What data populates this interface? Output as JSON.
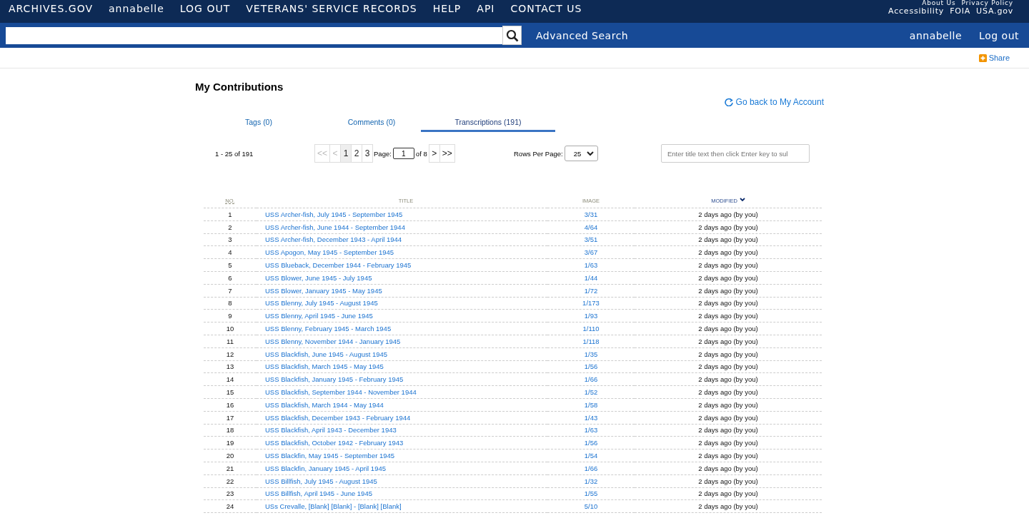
{
  "top_nav": {
    "items": [
      "ARCHIVES.GOV",
      "annabelle",
      "LOG OUT",
      "VETERANS' SERVICE RECORDS",
      "HELP",
      "API",
      "CONTACT US"
    ],
    "utility_links_top": [
      "About Us",
      "Privacy Policy"
    ],
    "utility_links": [
      "Accessibility",
      "FOIA",
      "USA.gov"
    ]
  },
  "search_bar": {
    "advanced_link": "Advanced Search",
    "user": "annabelle",
    "logout": "Log out"
  },
  "share": "Share",
  "page_title": "My Contributions",
  "back_link": "Go back to My Account",
  "tabs": [
    {
      "label": "Tags (0)",
      "selected": false
    },
    {
      "label": "Comments (0)",
      "selected": false
    },
    {
      "label": "Transcriptions (191)",
      "selected": true
    }
  ],
  "pager": {
    "range": "1 - 25 of 191",
    "buttons": [
      {
        "label": "<<",
        "disabled": true,
        "selected": false
      },
      {
        "label": "<",
        "disabled": true,
        "selected": false
      },
      {
        "label": "1",
        "disabled": false,
        "selected": true
      },
      {
        "label": "2",
        "disabled": false,
        "selected": false
      },
      {
        "label": "3",
        "disabled": false,
        "selected": false
      }
    ],
    "page_label": "Page:",
    "page_value": "1",
    "of": "of 8",
    "next_buttons": [
      ">",
      ">>"
    ],
    "rows_label": "Rows Per Page:",
    "rows_value": "25",
    "filter_placeholder": "Enter title text then click Enter key to sul"
  },
  "table": {
    "columns": [
      {
        "label": "NO.",
        "sorted": false
      },
      {
        "label": "TITLE",
        "sorted": false
      },
      {
        "label": "IMAGE",
        "sorted": false
      },
      {
        "label": "MODIFIED",
        "sorted": true
      }
    ],
    "rows": [
      [
        "1",
        "USS Archer-fish, July 1945 - September 1945",
        "3/31",
        "2 days ago (by you)"
      ],
      [
        "2",
        "USS Archer-fish, June 1944 - September 1944",
        "4/64",
        "2 days ago (by you)"
      ],
      [
        "3",
        "USS Archer-fish, December 1943 - April 1944",
        "3/51",
        "2 days ago (by you)"
      ],
      [
        "4",
        "USS Apogon, May 1945 - September 1945",
        "3/67",
        "2 days ago (by you)"
      ],
      [
        "5",
        "USS Blueback, December 1944 - February 1945",
        "1/63",
        "2 days ago (by you)"
      ],
      [
        "6",
        "USS Blower, June 1945 - July 1945",
        "1/44",
        "2 days ago (by you)"
      ],
      [
        "7",
        "USS Blower, January 1945 - May 1945",
        "1/72",
        "2 days ago (by you)"
      ],
      [
        "8",
        "USS Blenny, July 1945 - August 1945",
        "1/173",
        "2 days ago (by you)"
      ],
      [
        "9",
        "USS Blenny, April 1945 - June 1945",
        "1/93",
        "2 days ago (by you)"
      ],
      [
        "10",
        "USS Blenny, February 1945 - March 1945",
        "1/110",
        "2 days ago (by you)"
      ],
      [
        "11",
        "USS Blenny, November 1944 - January 1945",
        "1/118",
        "2 days ago (by you)"
      ],
      [
        "12",
        "USS Blackfish, June 1945 - August 1945",
        "1/35",
        "2 days ago (by you)"
      ],
      [
        "13",
        "USS Blackfish, March 1945 - May 1945",
        "1/56",
        "2 days ago (by you)"
      ],
      [
        "14",
        "USS Blackfish, January 1945 - February 1945",
        "1/66",
        "2 days ago (by you)"
      ],
      [
        "15",
        "USS Blackfish, September 1944 - November 1944",
        "1/52",
        "2 days ago (by you)"
      ],
      [
        "16",
        "USS Blackfish, March 1944 - May 1944",
        "1/58",
        "2 days ago (by you)"
      ],
      [
        "17",
        "USS Blackfish, December 1943 - February 1944",
        "1/43",
        "2 days ago (by you)"
      ],
      [
        "18",
        "USS Blackfish, April 1943 - December 1943",
        "1/63",
        "2 days ago (by you)"
      ],
      [
        "19",
        "USS Blackfish, October 1942 - February 1943",
        "1/56",
        "2 days ago (by you)"
      ],
      [
        "20",
        "USS Blackfin, May 1945 - September 1945",
        "1/54",
        "2 days ago (by you)"
      ],
      [
        "21",
        "USS Blackfin, January 1945 - April 1945",
        "1/66",
        "2 days ago (by you)"
      ],
      [
        "22",
        "USS Billfish, July 1945 - August 1945",
        "1/32",
        "2 days ago (by you)"
      ],
      [
        "23",
        "USS Billfish, April 1945 - June 1945",
        "1/55",
        "2 days ago (by you)"
      ],
      [
        "24",
        "USs Crevalle, [Blank] [Blank] - [Blank] [Blank]",
        "5/10",
        "2 days ago (by you)"
      ]
    ]
  }
}
